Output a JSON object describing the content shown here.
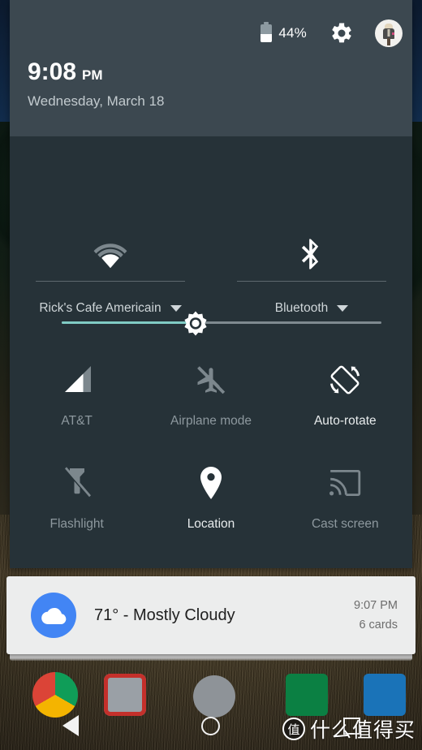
{
  "status_bar": {
    "battery_percent": "44%",
    "battery_icon": "battery-icon",
    "settings_icon": "gear-icon",
    "avatar_icon": "user-avatar"
  },
  "header": {
    "time": "9:08",
    "am_pm": "PM",
    "date": "Wednesday, March 18"
  },
  "brightness": {
    "icon": "brightness-sun-icon",
    "fill_percent": 42,
    "fill_color": "#80cbc4",
    "track_color": "#7f8a90"
  },
  "dual_tiles": [
    {
      "label": "Rick's Cafe Americain",
      "icon": "wifi-icon",
      "state": "on",
      "caret": "chevron-down-icon"
    },
    {
      "label": "Bluetooth",
      "icon": "bluetooth-icon",
      "state": "on",
      "caret": "chevron-down-icon"
    }
  ],
  "tiles_row_1": [
    {
      "label": "AT&T",
      "icon": "cell-signal-icon",
      "state": "on"
    },
    {
      "label": "Airplane mode",
      "icon": "airplane-off-icon",
      "state": "off"
    },
    {
      "label": "Auto-rotate",
      "icon": "auto-rotate-icon",
      "state": "on"
    }
  ],
  "tiles_row_2": [
    {
      "label": "Flashlight",
      "icon": "flashlight-off-icon",
      "state": "off"
    },
    {
      "label": "Location",
      "icon": "location-pin-icon",
      "state": "on"
    },
    {
      "label": "Cast screen",
      "icon": "cast-screen-icon",
      "state": "off"
    }
  ],
  "notification": {
    "icon": "weather-cloud-icon",
    "icon_color": "#4285f4",
    "title": "71° - Mostly Cloudy",
    "time": "9:07 PM",
    "subtitle": "6 cards"
  },
  "navbar": {
    "back": "back-triangle-icon",
    "home": "home-circle-icon",
    "recent": "recents-square-icon"
  },
  "watermark": {
    "logo_char": "值",
    "text": "什么值得买"
  },
  "colors": {
    "panel_body": "#263238",
    "panel_header": "#3c4850",
    "accent_teal": "#80cbc4",
    "label_on": "#e8eced",
    "label_off": "#8d989e",
    "card_bg": "#eceded"
  }
}
